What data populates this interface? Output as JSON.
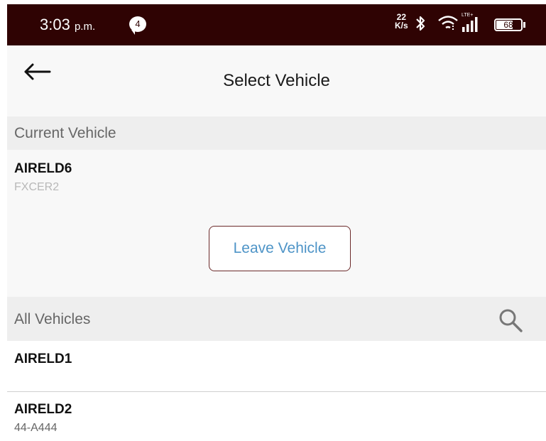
{
  "status_bar": {
    "time": "3:03",
    "ampm": "p.m.",
    "notification_count": "4",
    "net_speed_value": "22",
    "net_speed_unit": "K/s",
    "network_label": "LTE+",
    "battery_percent": "68",
    "battery_level": 0.68,
    "icons": [
      "chat-bubble-icon",
      "bluetooth-icon",
      "wifi-icon",
      "signal-icon",
      "battery-icon"
    ]
  },
  "app_bar": {
    "title": "Select Vehicle",
    "back_icon": "arrow-left-icon"
  },
  "current_vehicle": {
    "section_label": "Current Vehicle",
    "name": "AIRELD6",
    "plate": "FXCER2",
    "leave_button_label": "Leave Vehicle"
  },
  "all_vehicles": {
    "section_label": "All Vehicles",
    "search_icon": "search-icon",
    "items": [
      {
        "name": "AIRELD1",
        "plate": ""
      },
      {
        "name": "AIRELD2",
        "plate": "44-A444"
      }
    ]
  },
  "colors": {
    "status_bar": "#2f0303",
    "accent_text": "#4e94c7",
    "button_border": "#6b2a2a",
    "section_bg": "#eeeeee",
    "panel_bg": "#f8f8f8"
  }
}
